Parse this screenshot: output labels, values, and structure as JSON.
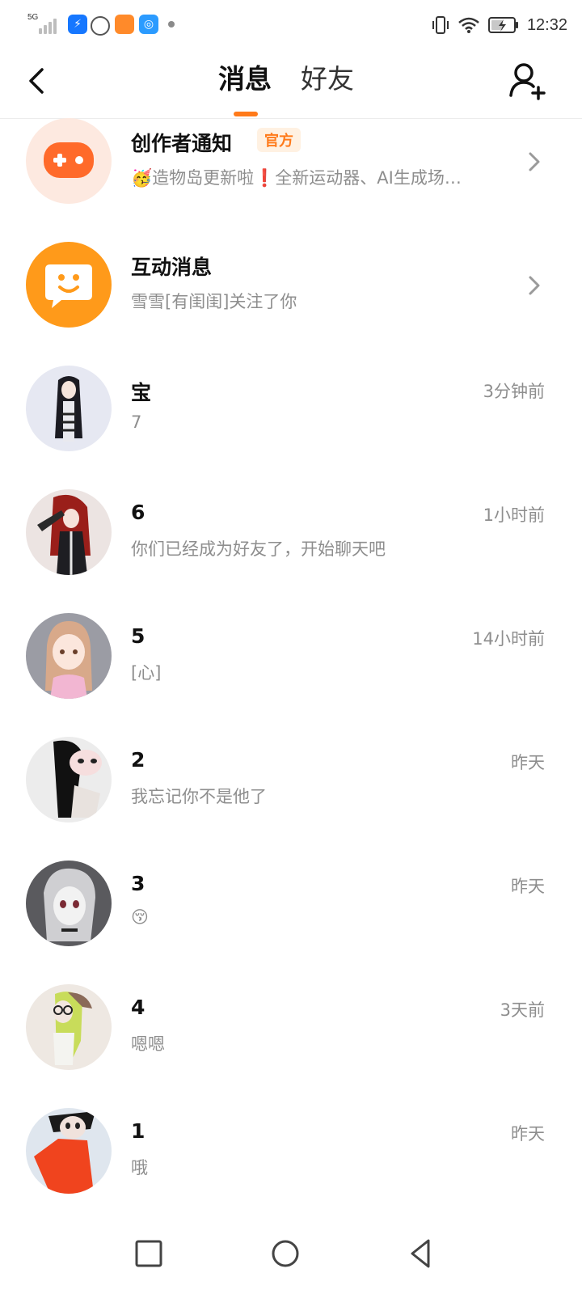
{
  "status_bar": {
    "network": "5G",
    "time": "12:32",
    "notification_icons": [
      "bolt-app-icon",
      "target-app-icon",
      "orange-app-icon",
      "browser-app-icon"
    ]
  },
  "header": {
    "tabs": [
      {
        "label": "消息",
        "active": true
      },
      {
        "label": "好友",
        "active": false
      }
    ]
  },
  "messages": [
    {
      "name": "创作者通知",
      "badge": "官方",
      "preview": "🥳造物岛更新啦❗全新运动器、AI生成场…",
      "time": "",
      "has_chevron": true,
      "avatar": "gamepad-icon"
    },
    {
      "name": "互动消息",
      "badge": "",
      "preview": "雪雪[有闺闺]关注了你",
      "time": "",
      "has_chevron": true,
      "avatar": "chat-bubble-icon"
    },
    {
      "name": "宝",
      "preview": "7",
      "time": "3分钟前",
      "avatar": "character-avatar"
    },
    {
      "name": "6",
      "preview": "你们已经成为好友了，开始聊天吧",
      "time": "1小时前",
      "avatar": "character-avatar"
    },
    {
      "name": "5",
      "preview": "[心]",
      "time": "14小时前",
      "avatar": "character-avatar"
    },
    {
      "name": "2",
      "preview": "我忘记你不是他了",
      "time": "昨天",
      "avatar": "character-avatar"
    },
    {
      "name": "3",
      "preview": "😚",
      "time": "昨天",
      "avatar": "character-avatar"
    },
    {
      "name": "4",
      "preview": "嗯嗯",
      "time": "3天前",
      "avatar": "character-avatar"
    },
    {
      "name": "1",
      "preview": "哦",
      "time": "昨天",
      "avatar": "character-avatar"
    }
  ],
  "colors": {
    "accent": "#ff7a1a",
    "text_primary": "#111111",
    "text_secondary": "#8e8e8e",
    "badge_bg": "#fff1e2"
  }
}
